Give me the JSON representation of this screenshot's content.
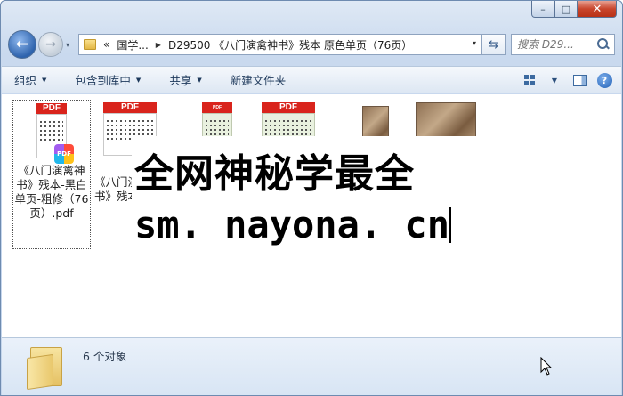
{
  "window": {
    "controls": {
      "minimize": "–",
      "maximize": "□",
      "close": "✕"
    }
  },
  "nav": {
    "back_label": "←",
    "forward_label": "→",
    "history_dropdown": "▾",
    "breadcrumb": {
      "overflow": "«",
      "items": [
        "国学...",
        "D29500 《八门演禽神书》残本 原色单页（76页）"
      ]
    },
    "address_dropdown": "▾",
    "refresh_label": "⇆",
    "search_placeholder": "搜索 D29..."
  },
  "toolbar": {
    "items": [
      "组织",
      "包含到库中",
      "共享",
      "新建文件夹"
    ],
    "dropdown_arrow": "▼",
    "views_dropdown": "▼",
    "help_label": "?"
  },
  "files": [
    {
      "name": "《八门演禽神书》残本-黑白单页-粗修（76页）.pdf",
      "type": "pdf",
      "selected": true
    },
    {
      "name": "《八门演禽神书》残本",
      "type": "pdf",
      "selected": false
    },
    {
      "name": "",
      "type": "pdf-green",
      "selected": false
    },
    {
      "name": "",
      "type": "pdf-green-wide",
      "selected": false
    },
    {
      "name": "",
      "type": "photo",
      "selected": false
    },
    {
      "name": "",
      "type": "photo-wide",
      "selected": false
    }
  ],
  "pdf_label": "PDF",
  "overlay": {
    "line1": "全网神秘学最全",
    "line2": "sm. nayona. cn"
  },
  "details": {
    "object_count": "6 个对象"
  }
}
